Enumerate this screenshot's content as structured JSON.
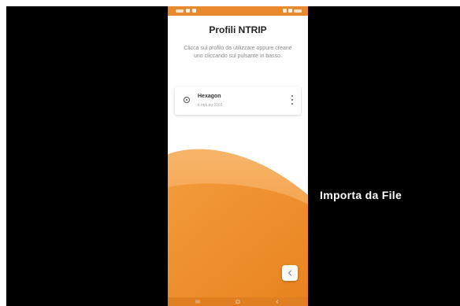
{
  "caption": {
    "text": "Importa da File"
  },
  "app": {
    "title": "Profili NTRIP",
    "description": "Clicca sul profilo da utilizzare oppure creane uno cliccando sul pulsante in basso.",
    "profiles": [
      {
        "name": "Hexagon",
        "detail": "it.ntrk.eu:2101",
        "selected": true
      }
    ],
    "fab_icon": "back-chevron-icon"
  },
  "colors": {
    "accent": "#f0922f",
    "accent_dark": "#e07f22",
    "background": "#000000",
    "title_text": "#222222",
    "muted_text": "#8a8a8a"
  }
}
